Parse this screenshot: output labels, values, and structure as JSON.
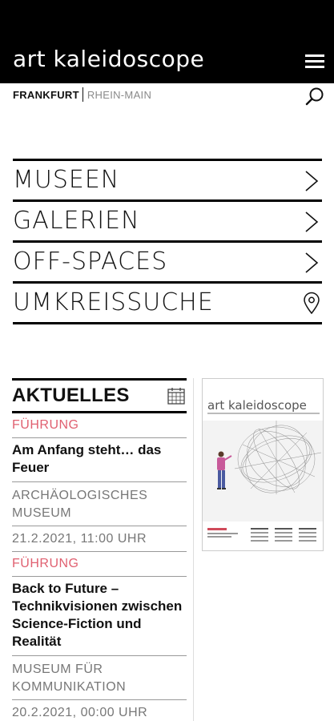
{
  "header": {
    "brand": "art kaleidoscope",
    "menu_icon": "hamburger-menu-icon"
  },
  "location": {
    "city": "FRANKFURT",
    "region": "RHEIN-MAIN",
    "search_icon": "search-icon"
  },
  "nav": {
    "items": [
      {
        "label": "MUSEEN",
        "icon": "chevron-right-icon"
      },
      {
        "label": "GALERIEN",
        "icon": "chevron-right-icon"
      },
      {
        "label": "OFF-SPACES",
        "icon": "chevron-right-icon"
      },
      {
        "label": "UMKREISSUCHE",
        "icon": "map-pin-icon"
      }
    ]
  },
  "events": {
    "title": "AKTUELLES",
    "calendar_icon": "calendar-icon",
    "items": [
      {
        "type": "FÜHRUNG",
        "title": "Am Anfang steht… das Feuer",
        "venue": "ARCHÄOLOGISCHES MUSEUM",
        "date": "21.2.2021, 11:00 UHR"
      },
      {
        "type": "FÜHRUNG",
        "title": "Back to Future – Technikvisionen zwischen Science-Fiction und Realität",
        "venue": "MUSEUM FÜR KOMMUNIKATION",
        "date": "20.2.2021, 00:00 UHR"
      }
    ]
  },
  "magazine": {
    "title": "art kaleidoscope",
    "accent_color": "#d04a5a"
  },
  "colors": {
    "header_bg": "#000000",
    "event_type": "#e06070",
    "muted_text": "#777777"
  }
}
